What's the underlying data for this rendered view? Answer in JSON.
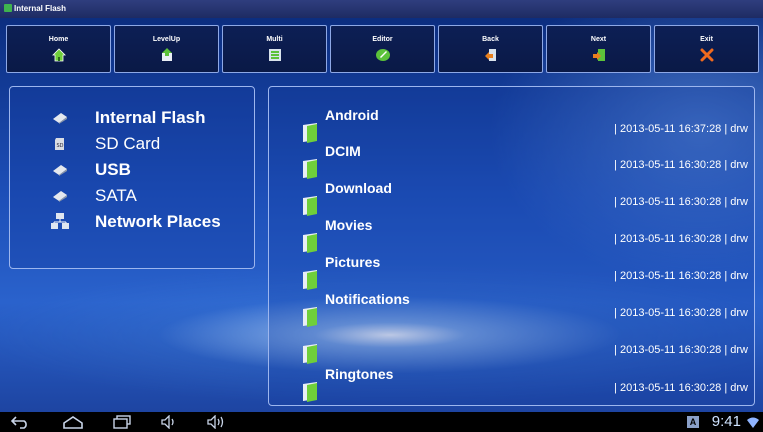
{
  "window": {
    "title": "Internal Flash"
  },
  "toolbar": {
    "buttons": [
      {
        "label": "Home",
        "icon": "home-icon"
      },
      {
        "label": "LevelUp",
        "icon": "level-up-icon"
      },
      {
        "label": "Multi",
        "icon": "multi-select-icon"
      },
      {
        "label": "Editor",
        "icon": "editor-icon"
      },
      {
        "label": "Back",
        "icon": "back-arrow-icon"
      },
      {
        "label": "Next",
        "icon": "next-arrow-icon"
      },
      {
        "label": "Exit",
        "icon": "exit-x-icon"
      }
    ]
  },
  "locations": [
    {
      "label": "Internal Flash",
      "icon": "flash-drive-icon",
      "bold": true
    },
    {
      "label": "SD Card",
      "icon": "sd-card-icon",
      "bold": false
    },
    {
      "label": "USB",
      "icon": "usb-drive-icon",
      "bold": true
    },
    {
      "label": "SATA",
      "icon": "sata-drive-icon",
      "bold": false
    },
    {
      "label": "Network Places",
      "icon": "network-places-icon",
      "bold": true
    }
  ],
  "files": [
    {
      "name": "Android",
      "info": "| 2013-05-11 16:37:28 | drw"
    },
    {
      "name": "DCIM",
      "info": "| 2013-05-11 16:30:28 | drw"
    },
    {
      "name": "Download",
      "info": "| 2013-05-11 16:30:28 | drw"
    },
    {
      "name": "Movies",
      "info": "| 2013-05-11 16:30:28 | drw"
    },
    {
      "name": "Pictures",
      "info": "| 2013-05-11 16:30:28 | drw"
    },
    {
      "name": "Notifications",
      "info": "| 2013-05-11 16:30:28 | drw"
    },
    {
      "name": "",
      "info": "| 2013-05-11 16:30:28 | drw"
    },
    {
      "name": "Ringtones",
      "info": "| 2013-05-11 16:30:28 | drw"
    }
  ],
  "navbar": {
    "clock": "9:41",
    "badge": "A",
    "colors": {
      "accent": "#3fb34f",
      "panel_border": "#9db6ee"
    }
  }
}
